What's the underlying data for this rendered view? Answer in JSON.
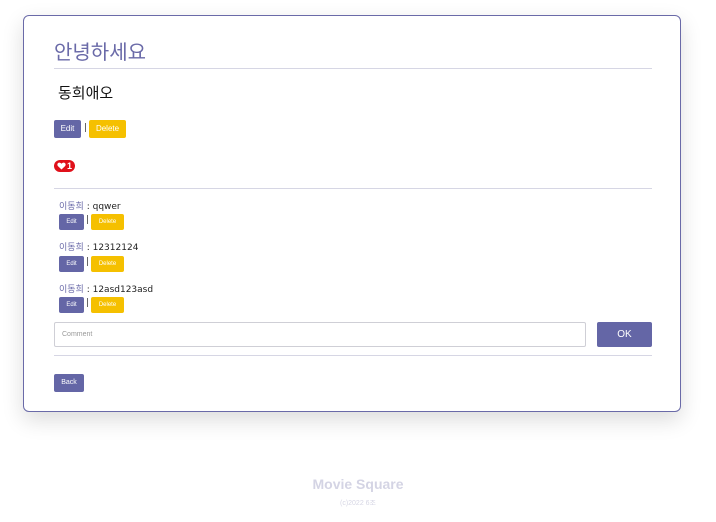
{
  "post": {
    "title": "안녕하세요",
    "content": "동희애오",
    "edit_label": "Edit",
    "delete_label": "Delete",
    "separator": "|",
    "likes": "1"
  },
  "comments": [
    {
      "author": "이동희",
      "sep": " : ",
      "text": "qqwer",
      "edit_label": "Edit",
      "delete_label": "Delete"
    },
    {
      "author": "이동희",
      "sep": " : ",
      "text": "12312124",
      "edit_label": "Edit",
      "delete_label": "Delete"
    },
    {
      "author": "이동희",
      "sep": " : ",
      "text": "12asd123asd",
      "edit_label": "Edit",
      "delete_label": "Delete"
    }
  ],
  "comment_form": {
    "placeholder": "Comment",
    "submit_label": "OK"
  },
  "back_label": "Back",
  "footer": {
    "brand": "Movie Square",
    "copyright": "(c)2022 6조"
  },
  "colors": {
    "primary": "#6466a6",
    "warning": "#f5c000",
    "like": "#e0101a"
  },
  "icons": {
    "like": "heart-icon"
  }
}
